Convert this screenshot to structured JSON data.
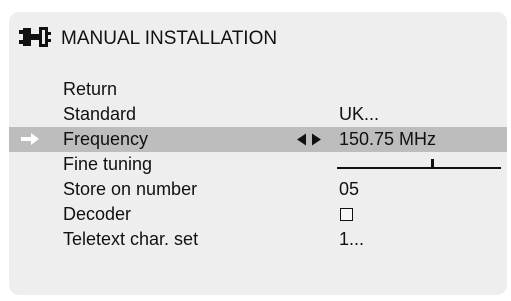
{
  "header": {
    "icon": "connector-plug-icon",
    "title": "MANUAL INSTALLATION"
  },
  "menu": {
    "items": [
      {
        "label": "Return",
        "value": ""
      },
      {
        "label": "Standard",
        "value": "UK..."
      },
      {
        "label": "Frequency",
        "value": "150.75 MHz",
        "selected": true,
        "adjust_icon": "left-right-arrows-icon"
      },
      {
        "label": "Fine tuning",
        "value": "",
        "slider_level": 0.58
      },
      {
        "label": "Store on number",
        "value": "05"
      },
      {
        "label": "Decoder",
        "value": "",
        "checked": false
      },
      {
        "label": "Teletext char. set",
        "value": "1..."
      }
    ],
    "pointer_icon": "right-arrow-pointer-icon"
  },
  "colors": {
    "panel_background": "#eeeeee",
    "selection_bar": "#bdbdbd",
    "text": "#111111",
    "pointer": "#ffffff"
  }
}
